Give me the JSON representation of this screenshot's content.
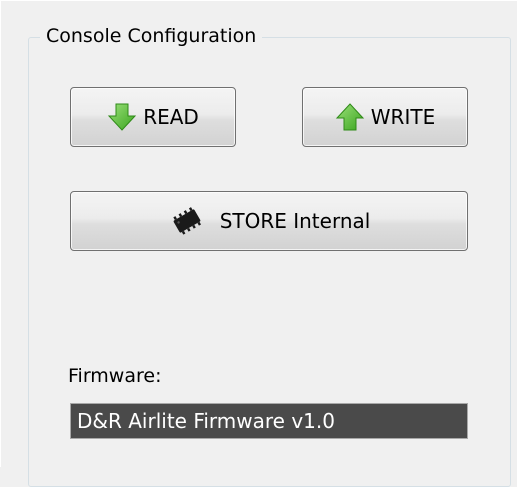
{
  "console_config": {
    "group_title": "Console Configuration",
    "read_button": {
      "label": "READ",
      "icon": "arrow-down-icon",
      "icon_color": "#5cc63c"
    },
    "write_button": {
      "label": "WRITE",
      "icon": "arrow-up-icon",
      "icon_color": "#5cc63c"
    },
    "store_button": {
      "label": "STORE Internal",
      "icon": "chip-icon"
    },
    "firmware": {
      "label": "Firmware:",
      "value": "D&R Airlite Firmware v1.0"
    }
  }
}
